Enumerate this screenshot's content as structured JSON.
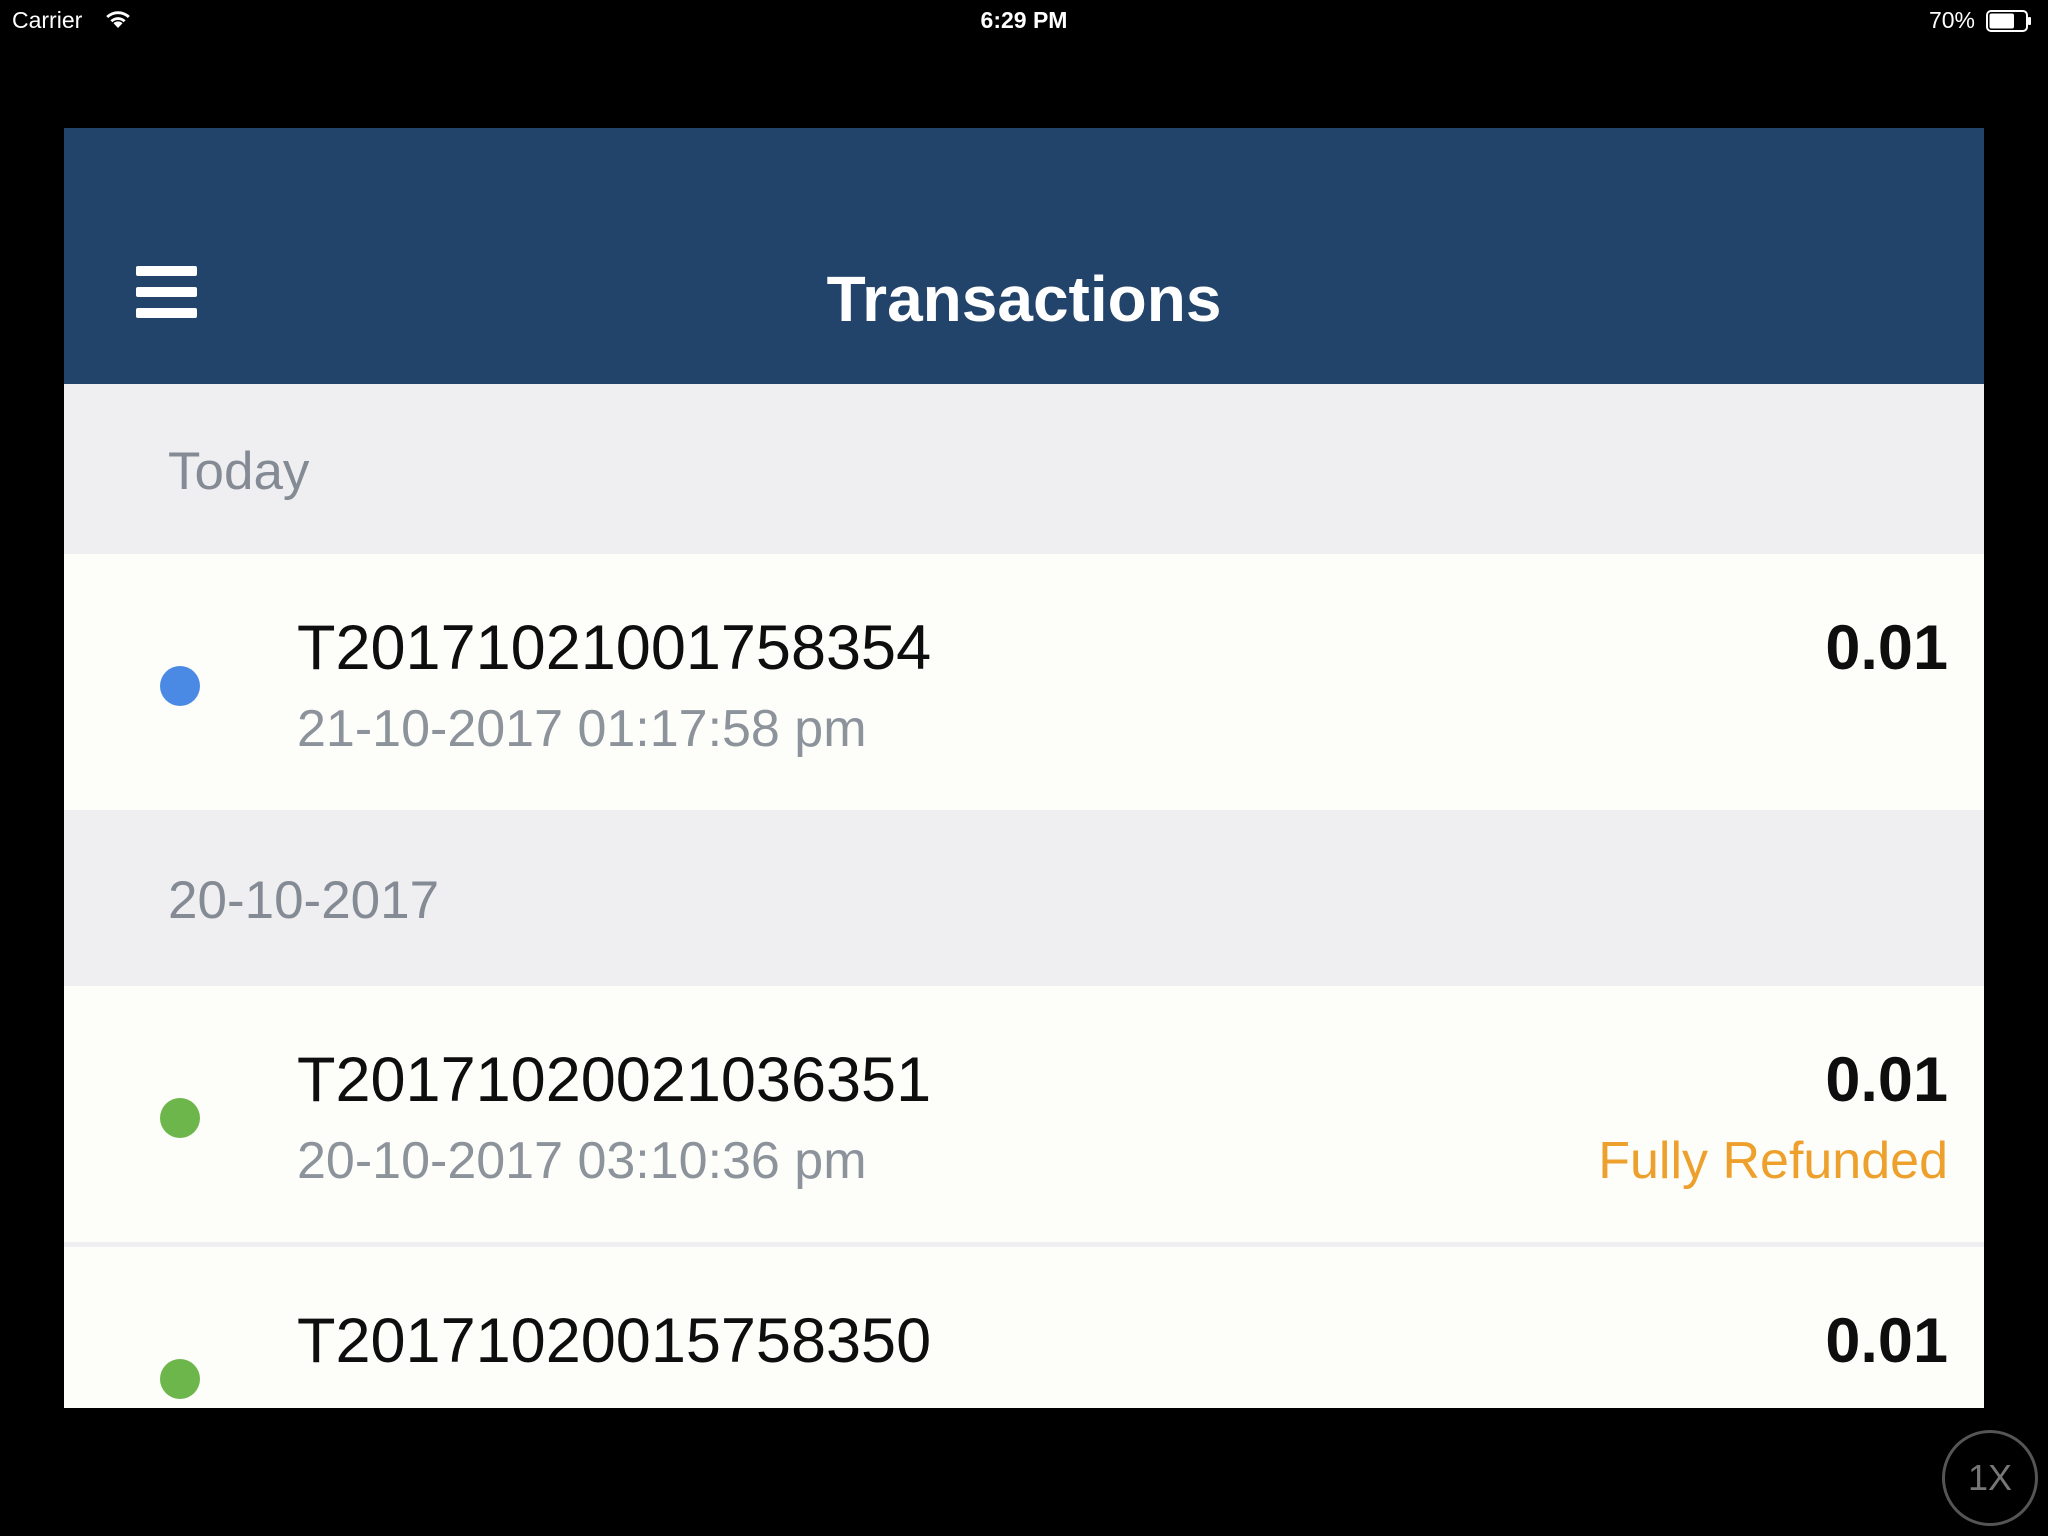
{
  "status_bar": {
    "carrier": "Carrier",
    "time": "6:29 PM",
    "battery_percent": "70%",
    "battery_level": 0.7,
    "wifi_icon": "wifi-icon"
  },
  "nav": {
    "title": "Transactions",
    "menu_icon": "hamburger-menu-icon"
  },
  "sections": [
    {
      "header": "Today",
      "transactions": [
        {
          "id": "T20171021001758354",
          "datetime": "21-10-2017 01:17:58 pm",
          "amount": "0.01",
          "status": "",
          "dot_color": "#4a8ae4"
        }
      ]
    },
    {
      "header": "20-10-2017",
      "transactions": [
        {
          "id": "T20171020021036351",
          "datetime": "20-10-2017 03:10:36 pm",
          "amount": "0.01",
          "status": "Fully Refunded",
          "dot_color": "#6db64c"
        },
        {
          "id": "T20171020015758350",
          "datetime": "",
          "amount": "0.01",
          "status": "",
          "dot_color": "#6db64c"
        }
      ]
    }
  ],
  "colors": {
    "nav_bar": "#23446a",
    "refunded": "#eda02b"
  },
  "overlay": {
    "speed_label": "1X"
  }
}
